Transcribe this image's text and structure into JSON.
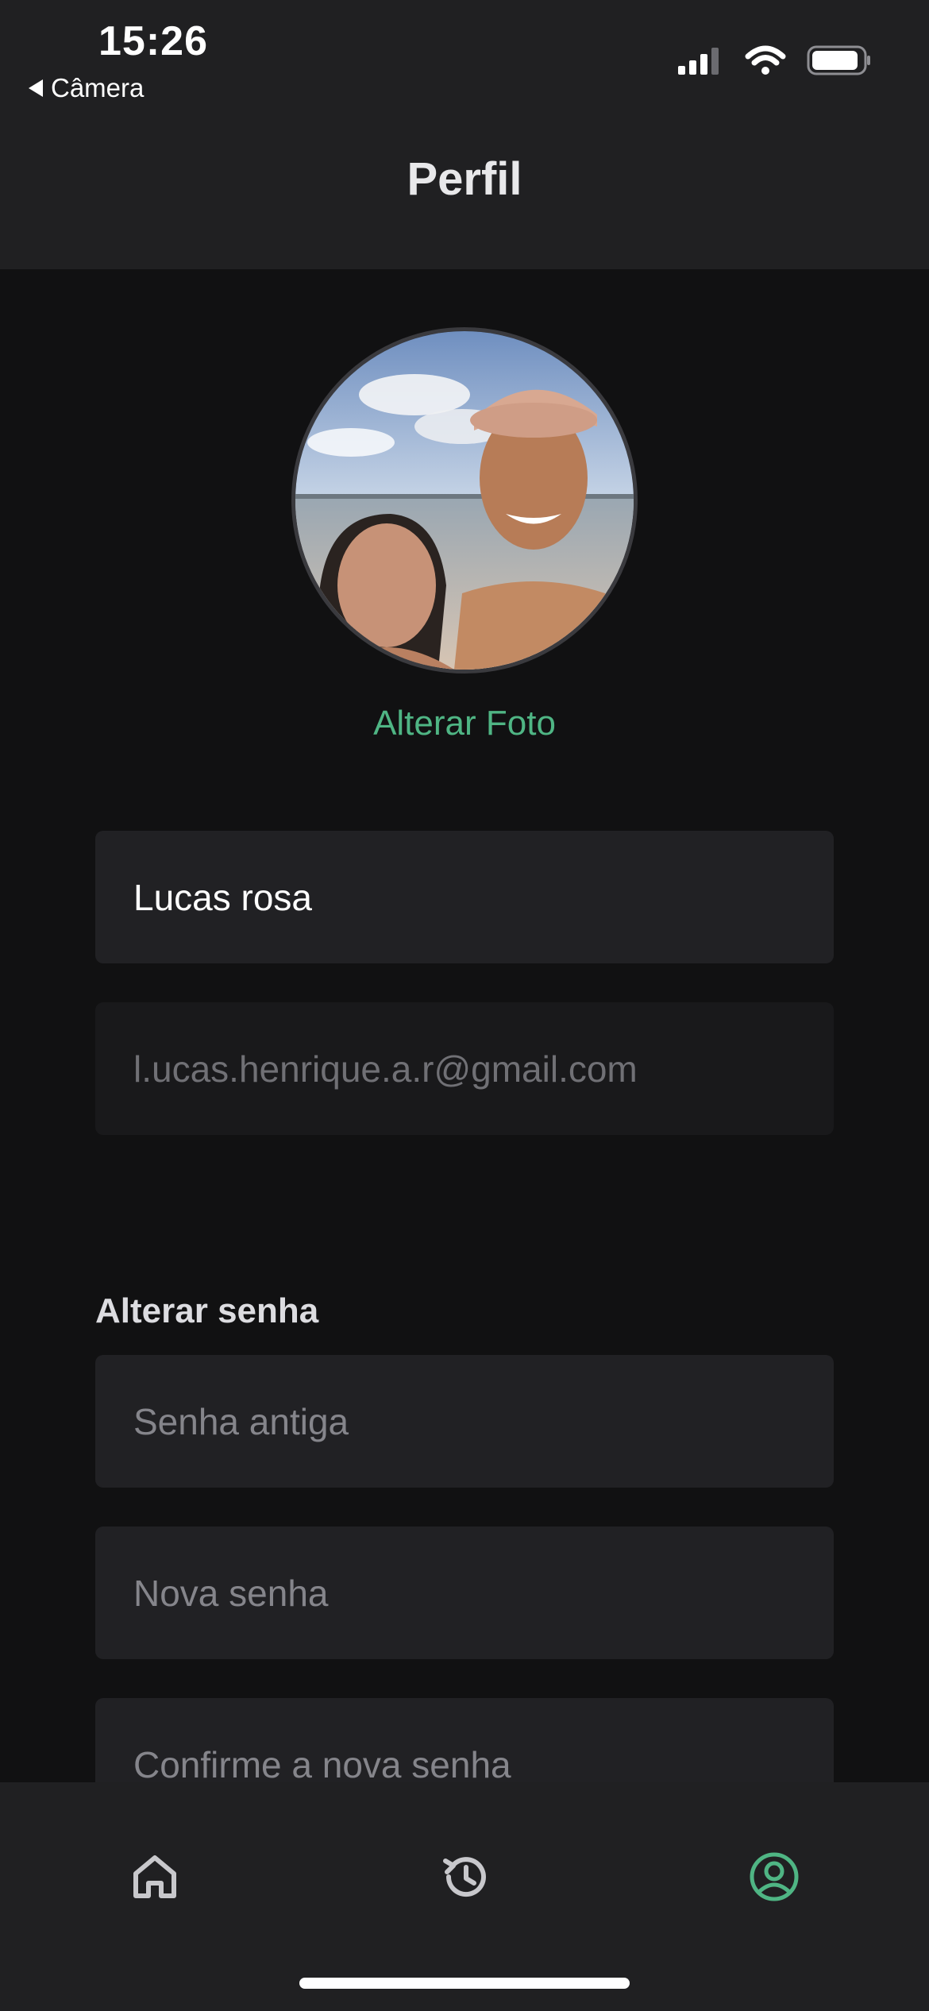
{
  "status_bar": {
    "time": "15:26",
    "back_label": "Câmera",
    "icons": [
      "signal-icon",
      "wifi-icon",
      "battery-icon"
    ]
  },
  "header": {
    "title": "Perfil"
  },
  "profile": {
    "avatar_icon": "profile-photo",
    "change_photo_label": "Alterar Foto"
  },
  "form": {
    "name_value": "Lucas rosa",
    "email_value": "l.ucas.henrique.a.r@gmail.com"
  },
  "password_section": {
    "label": "Alterar senha",
    "old_password_placeholder": "Senha antiga",
    "new_password_placeholder": "Nova senha",
    "confirm_password_placeholder": "Confirme a nova senha"
  },
  "tab_bar": {
    "items": [
      {
        "icon": "home-icon",
        "active": false
      },
      {
        "icon": "history-icon",
        "active": false
      },
      {
        "icon": "profile-icon",
        "active": true
      }
    ]
  },
  "colors": {
    "accent": "#4fb584",
    "background": "#111112",
    "surface": "#202022",
    "field": "#212124"
  }
}
